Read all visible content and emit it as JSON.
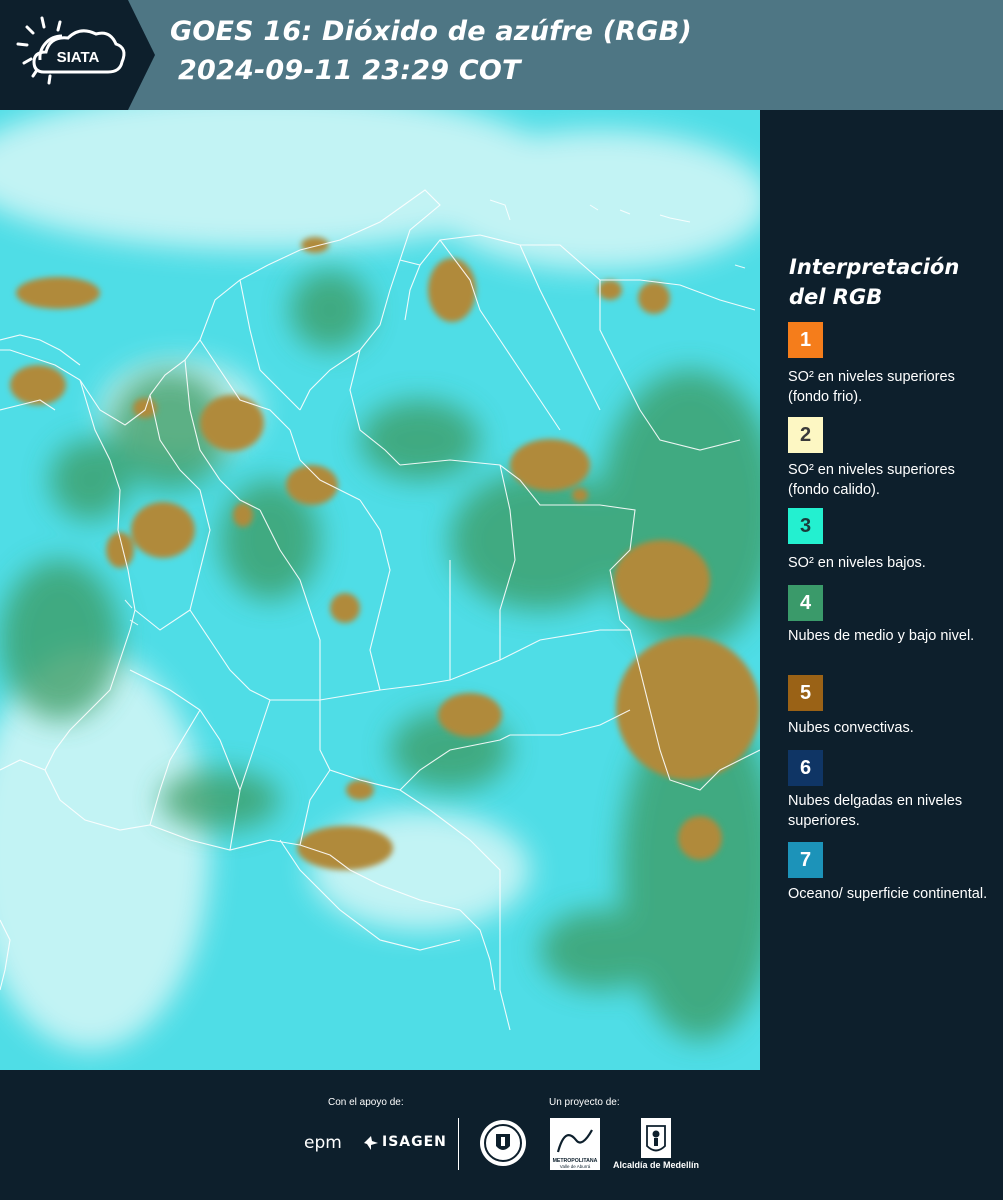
{
  "header": {
    "logo_text": "SIATA",
    "title_line1": "GOES 16: Dióxido de azúfre (RGB)",
    "title_line2": "2024-09-11 23:29 COT"
  },
  "legend": {
    "title": "Interpretación del RGB",
    "items": [
      {
        "num": "1",
        "color": "#f57d1b",
        "num_color": "#ffffff",
        "text": "SO² en niveles superiores (fondo frio)."
      },
      {
        "num": "2",
        "color": "#fdf7c3",
        "num_color": "#3a3a3a",
        "text": "SO² en niveles superiores (fondo calido)."
      },
      {
        "num": "3",
        "color": "#23f0d0",
        "num_color": "#1a3a3a",
        "text": "SO² en niveles bajos."
      },
      {
        "num": "4",
        "color": "#3a9a6a",
        "num_color": "#ffffff",
        "text": "Nubes de medio y bajo nivel."
      },
      {
        "num": "5",
        "color": "#9a6216",
        "num_color": "#ffffff",
        "text": "Nubes convectivas."
      },
      {
        "num": "6",
        "color": "#0f3565",
        "num_color": "#ffffff",
        "text": "Nubes delgadas en niveles superiores."
      },
      {
        "num": "7",
        "color": "#1c93b9",
        "num_color": "#ffffff",
        "text": "Oceano/ superficie continental."
      }
    ]
  },
  "footer": {
    "support_label": "Con el apoyo de:",
    "project_label": "Un proyecto de:",
    "epm": "epm",
    "isagen": "ISAGEN",
    "area_name": "METROPOLITANA",
    "area_sub": "Valle de Aburrá",
    "alcaldia": "Alcaldía de Medellín"
  },
  "map_colors": {
    "base_cyan": "#4fdde6",
    "cloud_white": "#e4faf9",
    "low_cloud_green": "#3a9a60",
    "convective_brown": "#b08a3a",
    "border_white": "#ffffff"
  }
}
